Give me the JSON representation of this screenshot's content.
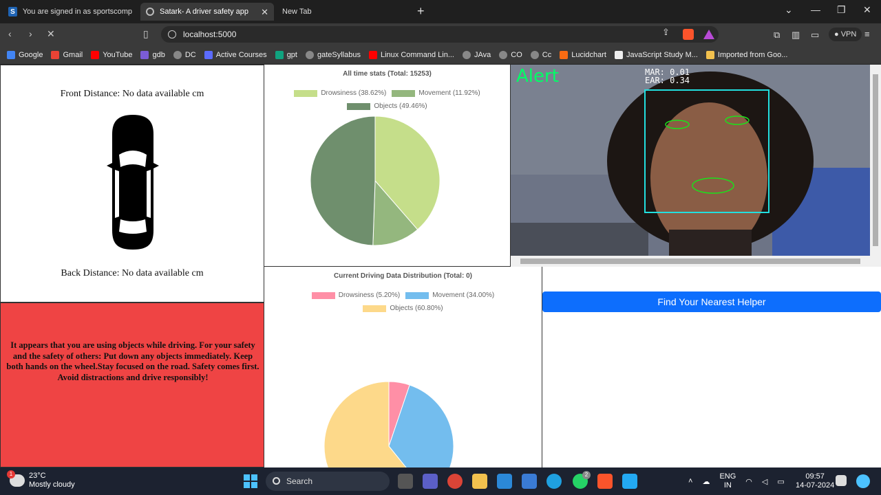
{
  "browser": {
    "tabs": [
      {
        "title": "You are signed in as sportscomplex",
        "favicon": "s-icon"
      },
      {
        "title": "Satark- A driver safety app",
        "favicon": "globe-icon"
      },
      {
        "title": "New Tab",
        "favicon": ""
      }
    ],
    "url": "localhost:5000",
    "vpn_label": "VPN",
    "bookmarks": [
      "Google",
      "Gmail",
      "YouTube",
      "gdb",
      "DC",
      "Active Courses",
      "gpt",
      "gateSyllabus",
      "Linux Command Lin...",
      "JAva",
      "CO",
      "Cc",
      "Lucidchart",
      "JavaScript Study M...",
      "Imported from Goo..."
    ]
  },
  "distance": {
    "front": "Front Distance: No data available cm",
    "back": "Back Distance: No data available cm"
  },
  "alert": {
    "message": "It appears that you are using objects while driving. For your safety and the safety of others: Put down any objects immediately. Keep both hands on the wheel.Stay focused on the road. Safety comes first. Avoid distractions and drive responsibly!",
    "bg_color": "#ef4444"
  },
  "camera": {
    "alert_label": "Alert",
    "mar": "MAR: 0.01",
    "ear": "EAR: 0.34"
  },
  "helper_button": "Find Your Nearest Helper",
  "chart_data": [
    {
      "type": "pie",
      "title": "All time stats (Total: 15253)",
      "legend": [
        "Drowsiness (38.62%)",
        "Movement (11.92%)",
        "Objects (49.46%)"
      ],
      "categories": [
        "Drowsiness",
        "Movement",
        "Objects"
      ],
      "values": [
        38.62,
        11.92,
        49.46
      ],
      "colors": [
        "#c5de8a",
        "#94b77e",
        "#6f8f6d"
      ],
      "legend_position": "top"
    },
    {
      "type": "pie",
      "title": "Current Driving Data Distribution (Total: 0)",
      "legend": [
        "Drowsiness (5.20%)",
        "Movement (34.00%)",
        "Objects (60.80%)"
      ],
      "categories": [
        "Drowsiness",
        "Movement",
        "Objects"
      ],
      "values": [
        5.2,
        34.0,
        60.8
      ],
      "colors": [
        "#ff8fa6",
        "#73bdee",
        "#fdd98a"
      ],
      "legend_position": "top"
    }
  ],
  "taskbar": {
    "temp": "23°C",
    "weather": "Mostly cloudy",
    "weather_badge": "1",
    "search": "Search",
    "whatsapp_badge": "2",
    "lang1": "ENG",
    "lang2": "IN",
    "time": "09:57",
    "date": "14-07-2024"
  }
}
